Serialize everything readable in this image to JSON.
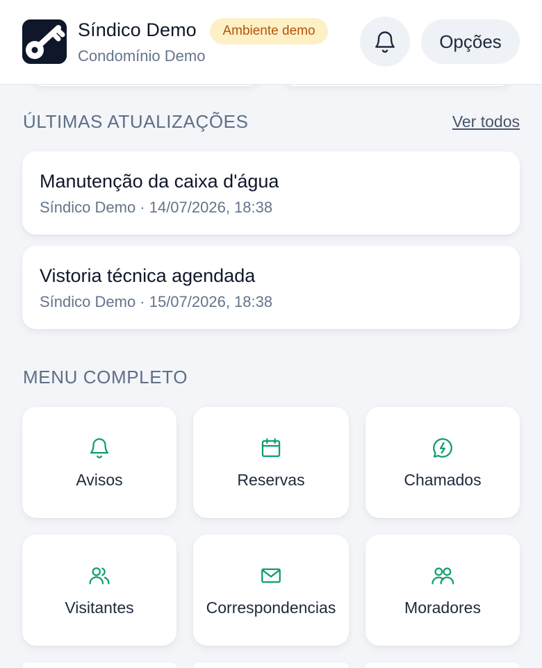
{
  "header": {
    "title": "Síndico Demo",
    "badge": "Ambiente demo",
    "subtitle": "Condomínio Demo",
    "options_label": "Opções"
  },
  "updates": {
    "section_title": "ÚLTIMAS ATUALIZAÇÕES",
    "see_all": "Ver todos",
    "items": [
      {
        "title": "Manutenção da caixa d'água",
        "meta": "Síndico Demo · 14/07/2026, 18:38"
      },
      {
        "title": "Vistoria técnica agendada",
        "meta": "Síndico Demo · 15/07/2026, 18:38"
      }
    ]
  },
  "menu": {
    "section_title": "MENU COMPLETO",
    "items": [
      {
        "label": "Avisos",
        "icon": "bell-icon"
      },
      {
        "label": "Reservas",
        "icon": "calendar-icon"
      },
      {
        "label": "Chamados",
        "icon": "lightning-chat-icon"
      },
      {
        "label": "Visitantes",
        "icon": "users-icon"
      },
      {
        "label": "Correspondencias",
        "icon": "mail-icon"
      },
      {
        "label": "Moradores",
        "icon": "residents-icon"
      }
    ]
  },
  "colors": {
    "accent": "#0f9d6b",
    "badge_bg": "#fdf0c5",
    "badge_text": "#b4530a",
    "logo_bg": "#0f172a"
  }
}
